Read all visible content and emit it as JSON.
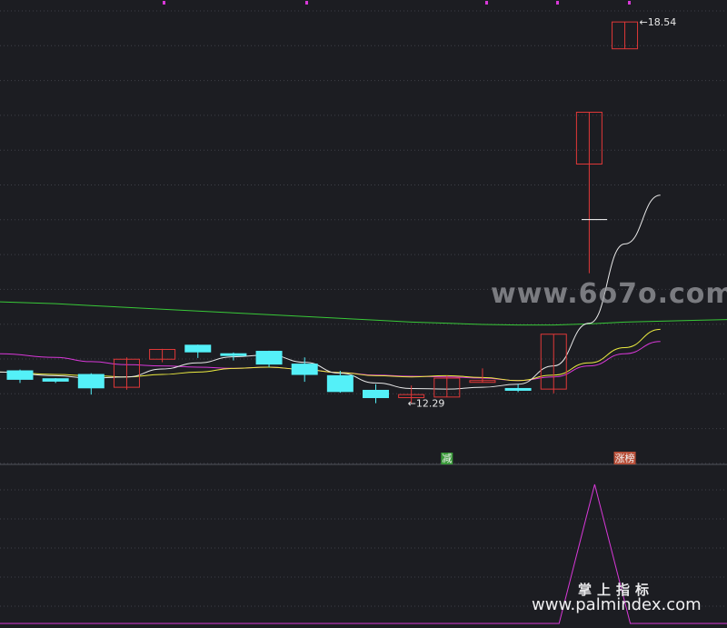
{
  "chart_data": {
    "type": "candlestick",
    "price_range": [
      11.3,
      18.9
    ],
    "candles": [
      {
        "o": 12.82,
        "c": 12.68,
        "h": 12.84,
        "l": 12.62
      },
      {
        "o": 12.69,
        "c": 12.65,
        "h": 12.7,
        "l": 12.62
      },
      {
        "o": 12.76,
        "c": 12.54,
        "h": 12.78,
        "l": 12.43
      },
      {
        "o": 12.55,
        "c": 13.01,
        "h": 13.04,
        "l": 12.51
      },
      {
        "o": 13.01,
        "c": 13.17,
        "h": 13.18,
        "l": 12.96
      },
      {
        "o": 13.24,
        "c": 13.13,
        "h": 13.25,
        "l": 13.03
      },
      {
        "o": 13.1,
        "c": 13.09,
        "h": 13.12,
        "l": 12.99
      },
      {
        "o": 13.14,
        "c": 12.93,
        "h": 13.15,
        "l": 12.88
      },
      {
        "o": 12.93,
        "c": 12.76,
        "h": 13.04,
        "l": 12.64
      },
      {
        "o": 12.74,
        "c": 12.48,
        "h": 12.82,
        "l": 12.46
      },
      {
        "o": 12.5,
        "c": 12.38,
        "h": 12.6,
        "l": 12.29
      },
      {
        "o": 12.38,
        "c": 12.43,
        "h": 12.58,
        "l": 12.29
      },
      {
        "o": 12.39,
        "c": 12.7,
        "h": 12.74,
        "l": 12.39
      },
      {
        "o": 12.65,
        "c": 12.66,
        "h": 12.86,
        "l": 12.63
      },
      {
        "o": 12.53,
        "c": 12.5,
        "h": 12.6,
        "l": 12.47
      },
      {
        "o": 12.52,
        "c": 13.42,
        "h": 13.42,
        "l": 12.45
      },
      {
        "o": 16.21,
        "c": 17.06,
        "h": 17.06,
        "l": 14.42
      },
      {
        "o": 18.1,
        "c": 18.54,
        "h": 18.54,
        "l": 18.1
      }
    ],
    "ma_white": [
      12.8,
      12.74,
      12.7,
      12.72,
      12.85,
      12.95,
      13.05,
      13.08,
      12.96,
      12.78,
      12.62,
      12.53,
      12.52,
      12.55,
      12.6,
      12.9,
      13.6,
      14.9,
      15.7
    ],
    "ma_yellow": [
      12.8,
      12.76,
      12.74,
      12.72,
      12.76,
      12.8,
      12.86,
      12.88,
      12.84,
      12.79,
      12.74,
      12.72,
      12.74,
      12.71,
      12.66,
      12.75,
      12.95,
      13.2,
      13.5
    ],
    "ma_magenta": [
      13.1,
      13.04,
      12.97,
      12.92,
      12.9,
      12.88,
      12.86,
      12.88,
      12.84,
      12.79,
      12.75,
      12.73,
      12.72,
      12.7,
      12.66,
      12.72,
      12.9,
      13.1,
      13.3
    ],
    "ma_green": [
      13.95,
      13.92,
      13.89,
      13.86,
      13.83,
      13.8,
      13.77,
      13.74,
      13.71,
      13.68,
      13.65,
      13.62,
      13.6,
      13.58,
      13.57,
      13.57,
      13.59,
      13.62,
      13.66
    ],
    "dash_marker_price": 15.3,
    "annotations": [
      {
        "text": "18.54",
        "candle": 17,
        "price": 18.54,
        "side": "right"
      },
      {
        "text": "12.29",
        "candle": 11,
        "price": 12.29,
        "side": "left"
      }
    ],
    "signals": [
      {
        "text": "减",
        "candle": 12,
        "color": "#3a9a3a"
      },
      {
        "text": "涨榜",
        "candle": 17,
        "color": "#b8503a"
      }
    ],
    "indicator": {
      "range": [
        0,
        1
      ],
      "values": [
        0,
        0,
        0,
        0,
        0,
        0,
        0,
        0,
        0,
        0,
        0,
        0,
        0,
        0,
        0,
        0,
        1,
        0,
        0
      ]
    },
    "colors": {
      "up": "#e03838",
      "down": "#54f0f8",
      "ma_white": "#e8e8e8",
      "ma_yellow": "#ecec40",
      "ma_magenta": "#d838d8",
      "ma_green": "#38c838",
      "indicator": "#d838d8",
      "grid": "#3e4048",
      "top_marks": "#d838d8",
      "divider": "#50525a"
    }
  },
  "watermark": {
    "site": "www.6o7o.com",
    "brand_cn": "掌上指标",
    "brand_url": "www.palmindex.com"
  }
}
